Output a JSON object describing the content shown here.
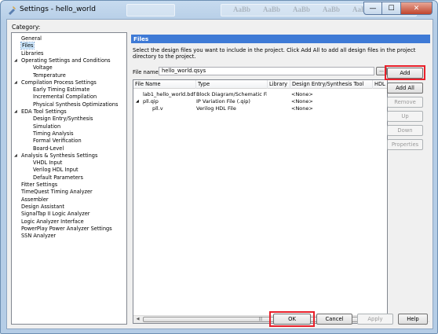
{
  "window": {
    "title": "Settings - hello_world",
    "ghost_text": "AaBb",
    "min_glyph": "—",
    "max_glyph": "☐",
    "close_glyph": "✕"
  },
  "category_label": "Category:",
  "tree": [
    {
      "label": "General",
      "indent": 0
    },
    {
      "label": "Files",
      "indent": 0,
      "selected": true
    },
    {
      "label": "Libraries",
      "indent": 0
    },
    {
      "label": "Operating Settings and Conditions",
      "indent": 0,
      "expanded": true
    },
    {
      "label": "Voltage",
      "indent": 1
    },
    {
      "label": "Temperature",
      "indent": 1
    },
    {
      "label": "Compilation Process Settings",
      "indent": 0,
      "expanded": true
    },
    {
      "label": "Early Timing Estimate",
      "indent": 1
    },
    {
      "label": "Incremental Compilation",
      "indent": 1
    },
    {
      "label": "Physical Synthesis Optimizations",
      "indent": 1
    },
    {
      "label": "EDA Tool Settings",
      "indent": 0,
      "expanded": true
    },
    {
      "label": "Design Entry/Synthesis",
      "indent": 1
    },
    {
      "label": "Simulation",
      "indent": 1
    },
    {
      "label": "Timing Analysis",
      "indent": 1
    },
    {
      "label": "Formal Verification",
      "indent": 1
    },
    {
      "label": "Board-Level",
      "indent": 1
    },
    {
      "label": "Analysis & Synthesis Settings",
      "indent": 0,
      "expanded": true
    },
    {
      "label": "VHDL Input",
      "indent": 1
    },
    {
      "label": "Verilog HDL Input",
      "indent": 1
    },
    {
      "label": "Default Parameters",
      "indent": 1
    },
    {
      "label": "Fitter Settings",
      "indent": 0
    },
    {
      "label": "TimeQuest Timing Analyzer",
      "indent": 0
    },
    {
      "label": "Assembler",
      "indent": 0
    },
    {
      "label": "Design Assistant",
      "indent": 0
    },
    {
      "label": "SignalTap II Logic Analyzer",
      "indent": 0
    },
    {
      "label": "Logic Analyzer Interface",
      "indent": 0
    },
    {
      "label": "PowerPlay Power Analyzer Settings",
      "indent": 0
    },
    {
      "label": "SSN Analyzer",
      "indent": 0
    }
  ],
  "panel": {
    "title": "Files",
    "description": "Select the design files you want to include in the project. Click Add All to add all design files in the project directory to the project.",
    "file_name_label": "File name:",
    "file_name_value": "hello_world.qsys",
    "browse_label": "...",
    "columns": [
      "File Name",
      "Type",
      "Library",
      "Design Entry/Synthesis Tool",
      "HDL"
    ],
    "rows": [
      {
        "file": "lab1_hello_world.bdf",
        "type": "Block Diagram/Schematic File",
        "library": "",
        "tool": "<None>",
        "indent": 1,
        "expander": ""
      },
      {
        "file": "pll.qip",
        "type": "IP Variation File (.qip)",
        "library": "",
        "tool": "<None>",
        "indent": 1,
        "expander": "◢"
      },
      {
        "file": "pll.v",
        "type": "Verilog HDL File",
        "library": "",
        "tool": "<None>",
        "indent": 2,
        "expander": ""
      }
    ],
    "scroll_left": "◀",
    "scroll_right": "▶",
    "scroll_grip": "|||"
  },
  "side_buttons": [
    {
      "label": "Add",
      "enabled": true,
      "highlighted": true
    },
    {
      "label": "Add All",
      "enabled": true
    },
    {
      "label": "Remove",
      "enabled": false
    },
    {
      "label": "Up",
      "enabled": false
    },
    {
      "label": "Down",
      "enabled": false
    },
    {
      "label": "Properties",
      "enabled": false
    }
  ],
  "footer": {
    "ok": "OK",
    "cancel": "Cancel",
    "apply": "Apply",
    "help": "Help"
  },
  "colors": {
    "header_bg": "#3e7ad6",
    "highlight": "#e8202a",
    "selection": "#cce8ff"
  }
}
